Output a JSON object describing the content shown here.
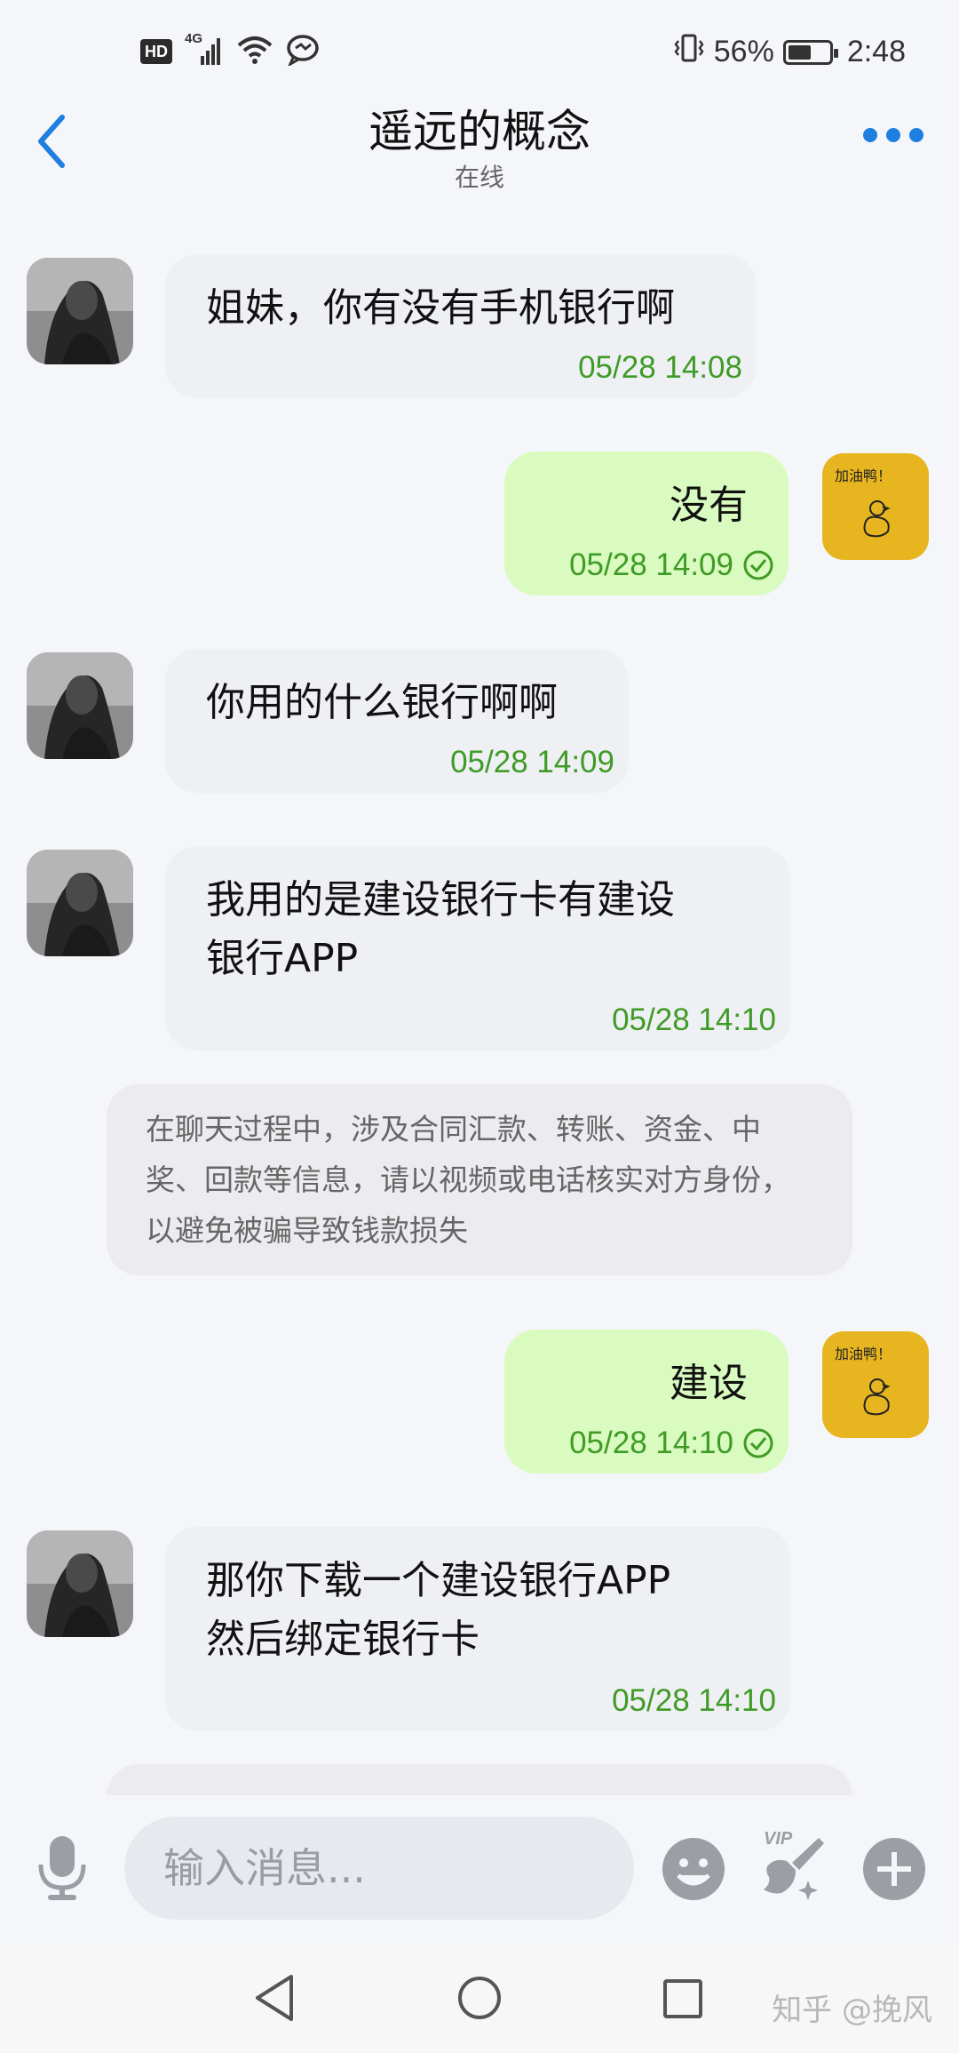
{
  "status_bar": {
    "hd": "HD",
    "network": "4G",
    "battery_percent": "56%",
    "battery_level": 0.56,
    "time": "2:48"
  },
  "header": {
    "contact_name": "遥远的概念",
    "contact_status": "在线"
  },
  "messages": [
    {
      "side": "in",
      "text": "姐妹，你有没有手机银行啊",
      "time": "05/28 14:08"
    },
    {
      "side": "out",
      "text": "没有",
      "time": "05/28 14:09",
      "status_icon": "check-circle-icon",
      "avatar_caption": "加油鸭！"
    },
    {
      "side": "in",
      "text": "你用的什么银行啊啊",
      "time": "05/28 14:09"
    },
    {
      "side": "in",
      "text": "我用的是建设银行卡有建设\n银行APP",
      "time": "05/28 14:10"
    },
    {
      "side": "notice",
      "text": "在聊天过程中，涉及合同汇款、转账、资金、中奖、回款等信息，请以视频或电话核实对方身份，以避免被骗导致钱款损失"
    },
    {
      "side": "out",
      "text": "建设",
      "time": "05/28 14:10",
      "status_icon": "check-circle-icon",
      "avatar_caption": "加油鸭！"
    },
    {
      "side": "in",
      "text": "那你下载一个建设银行APP\n然后绑定银行卡",
      "time": "05/28 14:10"
    }
  ],
  "input_bar": {
    "placeholder": "输入消息...",
    "vip_label": "VIP"
  },
  "watermark": "知乎 @挽风",
  "colors": {
    "accent": "#1e7fe0",
    "incoming_bubble": "#eef0f4",
    "outgoing_bubble": "#d9fbbf",
    "timestamp": "#3f9b26",
    "notice_bg": "#ececf0"
  }
}
